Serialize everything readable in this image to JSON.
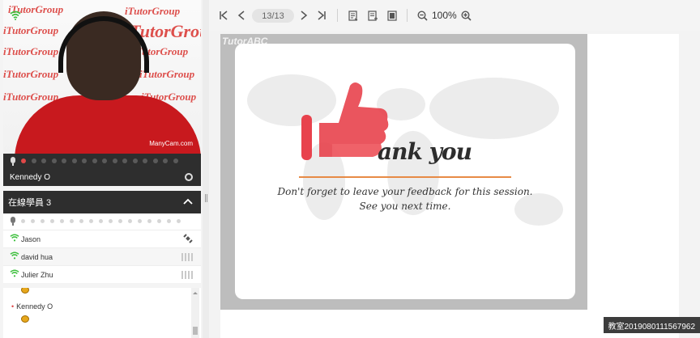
{
  "video": {
    "watermark": "iTutorGroup",
    "camera_tag": "ManyCam.com",
    "teacher_name": "Kennedy O",
    "signal_icon": "wifi-icon",
    "active_dot_color": "#e04848"
  },
  "toolbar": {
    "first_icon": "first-page-icon",
    "prev_icon": "prev-page-icon",
    "page_indicator": "13/13",
    "next_icon": "next-page-icon",
    "last_icon": "last-page-icon",
    "doc_icon_1": "document-list-icon",
    "doc_icon_2": "document-add-icon",
    "doc_icon_3": "bookmark-icon",
    "zoom_out_icon": "zoom-out-icon",
    "zoom_level": "100%",
    "zoom_in_icon": "zoom-in-icon"
  },
  "students": {
    "header": "在線學員 3",
    "items": [
      {
        "name": "Jason",
        "status_icon": "satellite-icon"
      },
      {
        "name": "david hua",
        "status_icon": "audio-bars-icon"
      },
      {
        "name": "Julier Zhu",
        "status_icon": "audio-bars-icon"
      }
    ]
  },
  "chat": {
    "messages": [
      {
        "author": "",
        "content": "hand-raise-icon"
      },
      {
        "author": "Kennedy O",
        "content": "hand-raise-icon"
      }
    ]
  },
  "slide": {
    "brand_tag": "TutorABC",
    "title_rest": "ank you",
    "feedback_line1": "Don't forget to leave your feedback for this session.",
    "feedback_line2": "See you next time.",
    "accent_color": "#e8424d",
    "rule_color": "#e78a45"
  },
  "room_badge": "教室2019080111567962"
}
